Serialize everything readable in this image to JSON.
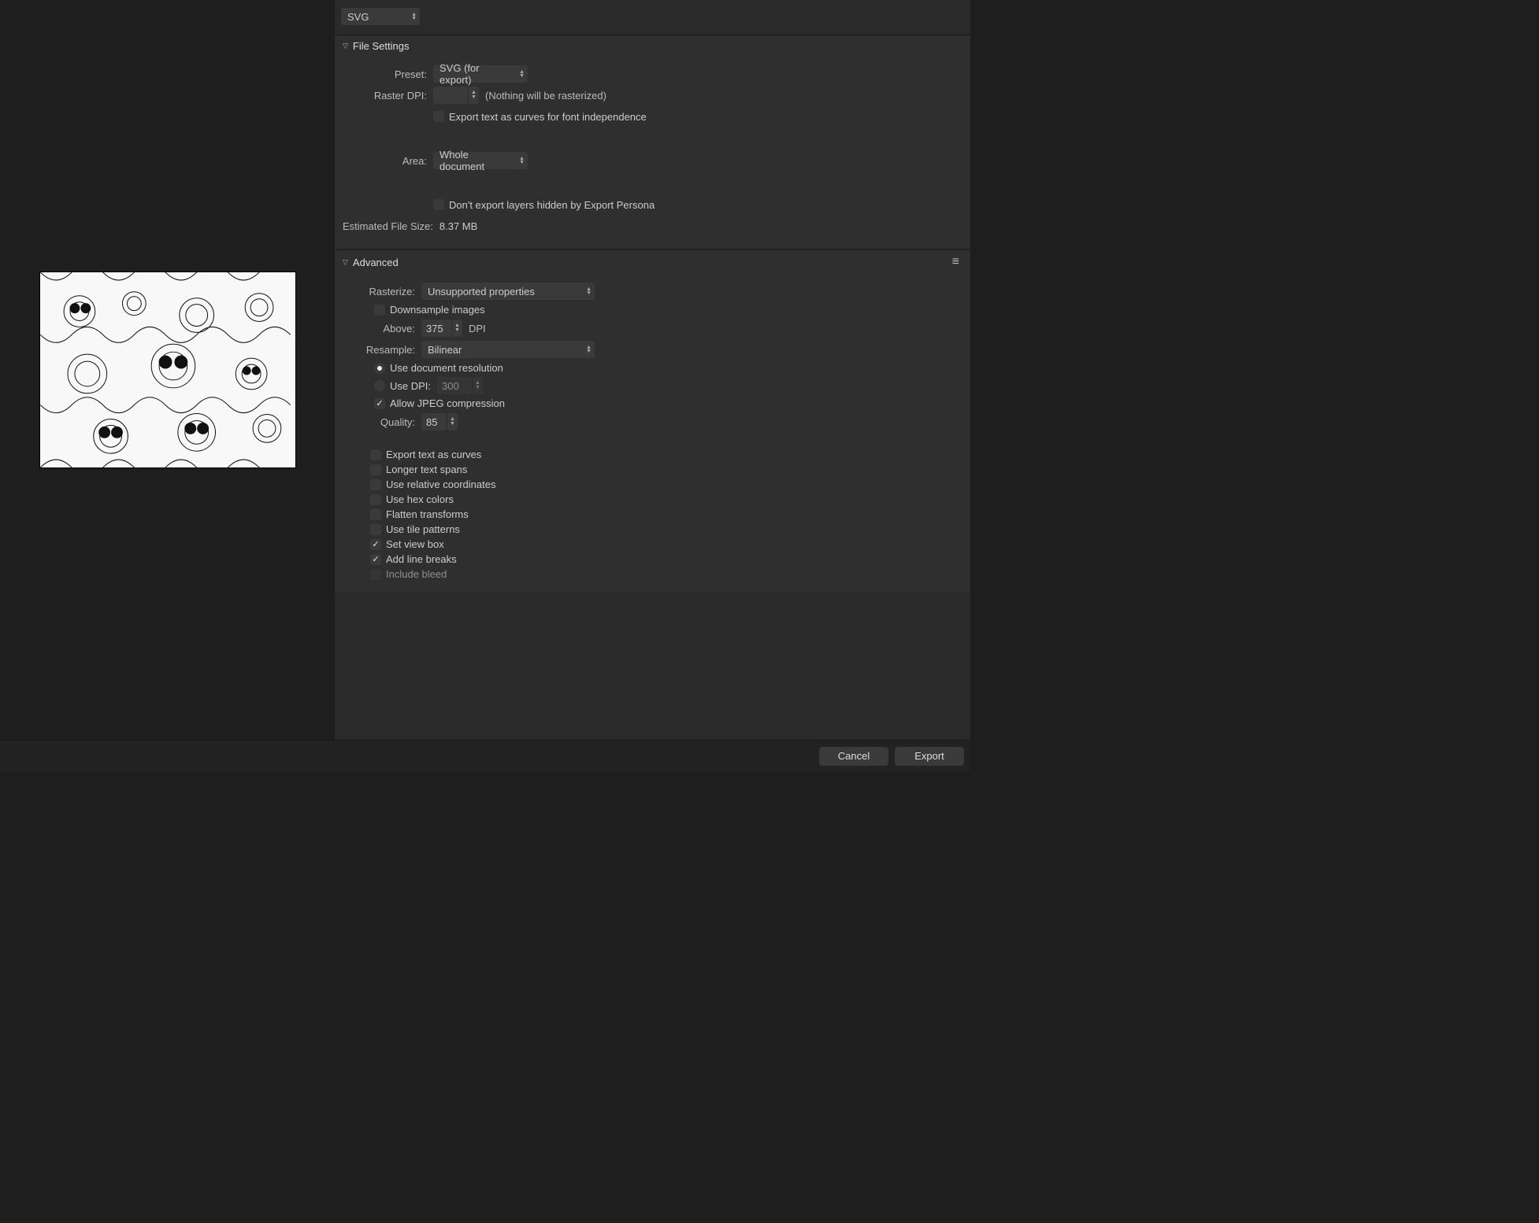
{
  "format": "SVG",
  "fileSettings": {
    "title": "File Settings",
    "presetLabel": "Preset:",
    "preset": "SVG (for export)",
    "rasterDpiLabel": "Raster DPI:",
    "rasterDpi": "",
    "rasterHint": "(Nothing will be rasterized)",
    "exportTextAsCurves": "Export text as curves for font independence",
    "areaLabel": "Area:",
    "area": "Whole document",
    "dontExportHidden": "Don't export layers hidden by Export Persona",
    "estimatedLabel": "Estimated File Size:",
    "estimated": "8.37 MB"
  },
  "advanced": {
    "title": "Advanced",
    "rasterizeLabel": "Rasterize:",
    "rasterize": "Unsupported properties",
    "downsample": "Downsample images",
    "aboveLabel": "Above:",
    "aboveValue": "375",
    "dpiSuffix": "DPI",
    "resampleLabel": "Resample:",
    "resample": "Bilinear",
    "useDocResolution": "Use document resolution",
    "useDpiLabel": "Use DPI:",
    "useDpiValue": "300",
    "allowJpeg": "Allow JPEG compression",
    "qualityLabel": "Quality:",
    "qualityValue": "85",
    "exportTextAsCurves2": "Export text as curves",
    "longerTextSpans": "Longer text spans",
    "useRelativeCoords": "Use relative coordinates",
    "useHexColors": "Use hex colors",
    "flattenTransforms": "Flatten transforms",
    "useTilePatterns": "Use tile patterns",
    "setViewBox": "Set view box",
    "addLineBreaks": "Add line breaks",
    "includeBleed": "Include bleed"
  },
  "footer": {
    "cancel": "Cancel",
    "export": "Export"
  }
}
